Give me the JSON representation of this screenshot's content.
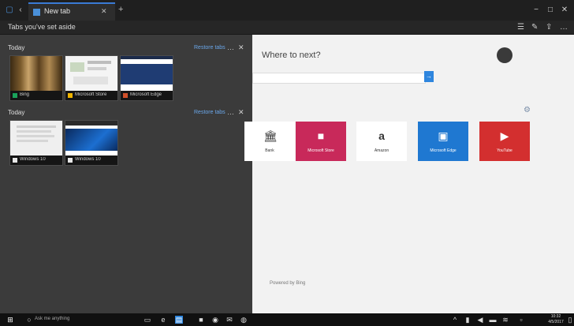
{
  "browser": {
    "tab_label": "New tab",
    "new_tab_symbol": "+",
    "close_symbol": "✕",
    "window_icons": [
      "−",
      "□",
      "✕"
    ]
  },
  "toolbar": {
    "title": "Tabs you've set aside",
    "icons": [
      "reading-list-icon",
      "note-icon",
      "share-icon",
      "more-icon"
    ]
  },
  "groups": [
    {
      "title": "Today",
      "restore_label": "Restore tabs",
      "more": "…",
      "close": "✕",
      "tabs": [
        {
          "label": "Bing",
          "favicon_color": "#1aa25a",
          "thumb": "forest"
        },
        {
          "label": "Microsoft Store",
          "favicon_color": "#f0b400",
          "thumb": "store"
        },
        {
          "label": "Microsoft Edge",
          "favicon_color": "#d0502a",
          "thumb": "dark"
        }
      ]
    },
    {
      "title": "Today",
      "restore_label": "Restore tabs",
      "more": "…",
      "close": "✕",
      "tabs": [
        {
          "label": "Windows 10",
          "favicon_color": "#e6e6e6",
          "thumb": "doc"
        },
        {
          "label": "Windows 10",
          "favicon_color": "#e6e6e6",
          "thumb": "win"
        }
      ]
    }
  ],
  "newtab": {
    "heading": "Where to next?",
    "search_placeholder": "",
    "go_symbol": "→",
    "footer": "Powered by Bing",
    "top_sites": [
      {
        "label": "Bank",
        "bg": "#ffffff",
        "fg": "#333333",
        "icon": "🏛"
      },
      {
        "label": "Microsoft Store",
        "bg": "#c8295a",
        "fg": "#ffffff",
        "icon": "■"
      },
      {
        "label": "Amazon",
        "bg": "#ffffff",
        "fg": "#333333",
        "icon": "a"
      },
      {
        "label": "Microsoft Edge",
        "bg": "#1f78d1",
        "fg": "#ffffff",
        "icon": "▣"
      },
      {
        "label": "YouTube",
        "bg": "#d32f2f",
        "fg": "#ffffff",
        "icon": "▶"
      }
    ]
  },
  "taskbar": {
    "search_text": "Ask me anything",
    "time": "10:32",
    "date": "4/5/2017"
  }
}
